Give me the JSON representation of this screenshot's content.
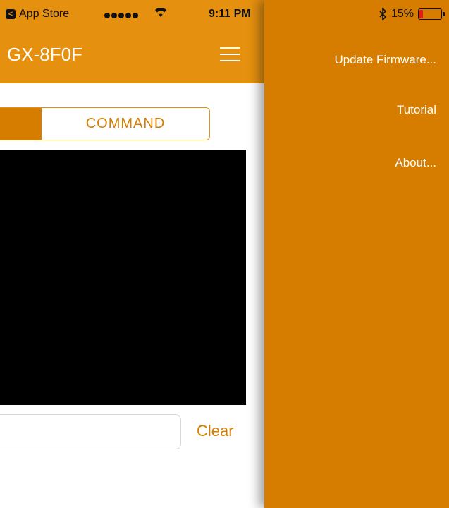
{
  "status_bar": {
    "back_label": "App Store",
    "back_glyph": "<",
    "time": "9:11 PM",
    "battery": "15%",
    "battery_level": 0.15
  },
  "nav": {
    "title": "GX-8F0F"
  },
  "segmented": {
    "right_label": "COMMAND"
  },
  "command": {
    "placeholder": "",
    "clear_label": "Clear"
  },
  "side_menu": {
    "items": [
      {
        "label": "Update Firmware..."
      },
      {
        "label": "Tutorial"
      },
      {
        "label": "About..."
      }
    ]
  },
  "colors": {
    "header": "#e5900f",
    "menu_bg": "#d67d00",
    "console_bg": "#000000"
  }
}
